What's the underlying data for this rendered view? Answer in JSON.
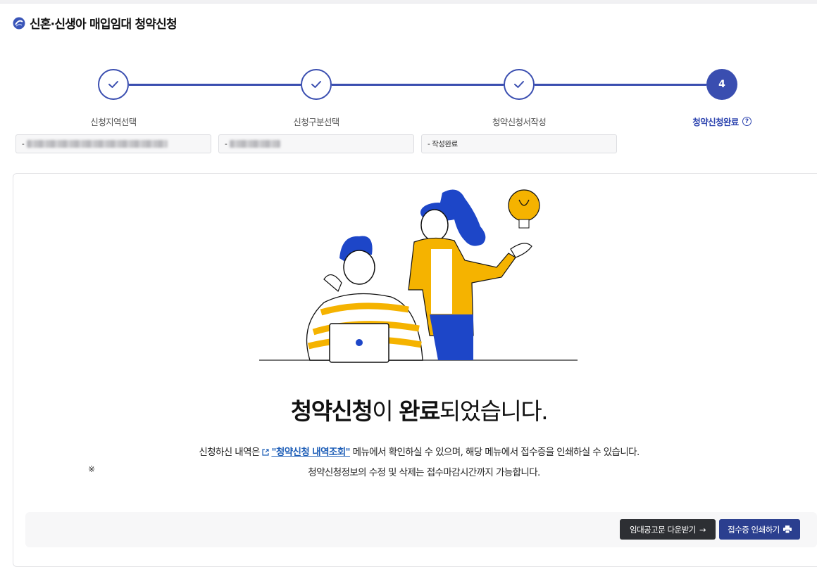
{
  "page": {
    "title": "신혼·신생아 매입임대 청약신청"
  },
  "steps": [
    {
      "label": "신청지역선택",
      "status": "done",
      "box_prefix": "-",
      "box_value": ""
    },
    {
      "label": "신청구분선택",
      "status": "done",
      "box_prefix": "-",
      "box_value": ""
    },
    {
      "label": "청약신청서작성",
      "status": "done",
      "box_prefix": "-",
      "box_value": "작성완료"
    },
    {
      "label": "청약신청완료",
      "status": "current",
      "number": "4"
    }
  ],
  "help_icon_glyph": "?",
  "result": {
    "headline_bold1": "청약신청",
    "headline_text1": "이 ",
    "headline_bold2": "완료",
    "headline_text2": "되었습니다.",
    "desc_before": "신청하신 내역은 ",
    "desc_link": "\"청약신청 내역조회\"",
    "desc_after": " 메뉴에서 확인하실 수 있으며, 해당 메뉴에서 접수증을 인쇄하실 수 있습니다.",
    "note_mark": "※",
    "note_text": "청약신청정보의 수정 및 삭제는 접수마감시간까지 가능합니다."
  },
  "buttons": {
    "download_label": "임대공고문 다운받기",
    "download_icon": "→",
    "print_label": "접수증 인쇄하기"
  },
  "colors": {
    "accent": "#3a4eb0",
    "link": "#1f5fb8",
    "dark_button": "#2d2f33",
    "blue_button": "#2b3f8f"
  }
}
